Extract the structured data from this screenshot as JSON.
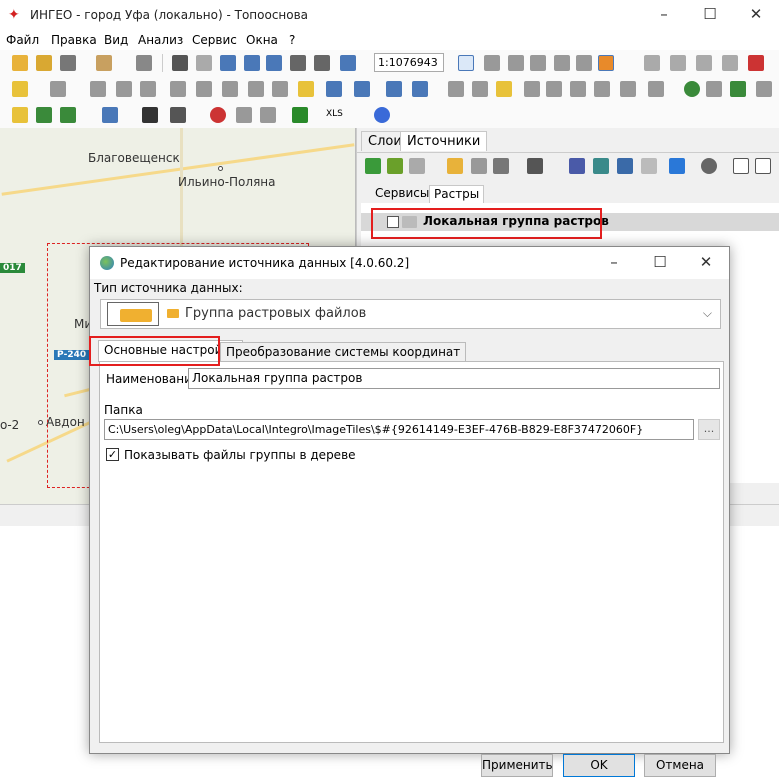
{
  "app": {
    "title": "ИНГЕО - город Уфа (локально) - Топооснова",
    "minimize": "–",
    "maximize": "☐",
    "close": "✕"
  },
  "menu": [
    "Файл",
    "Правка",
    "Вид",
    "Анализ",
    "Сервис",
    "Окна",
    "?"
  ],
  "toolbar": {
    "scale": "1:1076943",
    "xls_label": "XLS"
  },
  "map": {
    "cities": [
      "Благовещенск",
      "Ильино-Поляна",
      "Ми",
      "Авдон",
      "о-2"
    ],
    "roads": [
      "017",
      "Р-240"
    ]
  },
  "panel": {
    "tabs": [
      "Слои",
      "Источники"
    ],
    "subtabs": [
      "Сервисы",
      "Растры"
    ],
    "tree_item": "Локальная группа растров"
  },
  "dialog": {
    "title": "Редактирование источника данных [4.0.60.2]",
    "minimize": "–",
    "maximize": "☐",
    "close": "✕",
    "source_type_label": "Тип источника данных:",
    "source_type_value": "Группа растровых файлов",
    "tabs": [
      "Основные настройки",
      "Преобразование системы координат"
    ],
    "name_label": "Наименование",
    "name_value": "Локальная группа растров",
    "folder_label": "Папка",
    "folder_value": "C:\\Users\\oleg\\AppData\\Local\\Integro\\ImageTiles\\$#{92614149-E3EF-476B-B829-E8F37472060F}",
    "browse_label": "...",
    "show_tree_label": "Показывать файлы группы в дереве",
    "show_tree_checked": "✓",
    "buttons": {
      "apply": "Применить",
      "ok": "OK",
      "cancel": "Отмена"
    }
  }
}
